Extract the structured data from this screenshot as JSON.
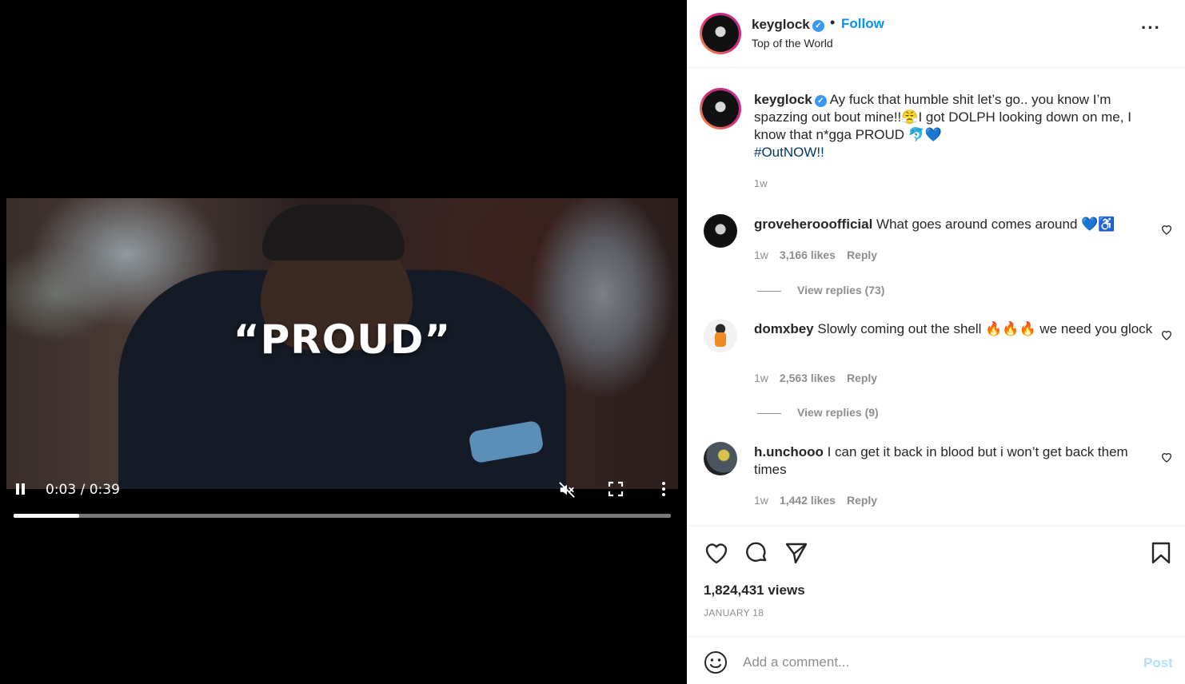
{
  "video": {
    "overlay_title": "“PROUD”",
    "time_label": "0:03 / 0:39",
    "progress_fraction": 0.1,
    "muted": true
  },
  "header": {
    "username": "keyglock",
    "verified": true,
    "separator": "•",
    "follow_label": "Follow",
    "subtitle": "Top of the World",
    "more_icon": "more-horizontal-icon"
  },
  "caption": {
    "username": "keyglock",
    "text": "Ay fuck that humble shit let’s go.. you know I’m spazzing out bout mine!!😤I got DOLPH looking down on me, I know that n*gga PROUD 🐬💙",
    "hashtag": "#OutNOW!!",
    "time": "1w"
  },
  "comments": [
    {
      "username": "groveherooofficial",
      "text": "What goes around comes around 💙♿",
      "time": "1w",
      "likes": "3,166 likes",
      "reply": "Reply",
      "view_replies": "View replies (73)"
    },
    {
      "username": "domxbey",
      "text": "Slowly coming out the shell 🔥🔥🔥 we need you glock",
      "time": "1w",
      "likes": "2,563 likes",
      "reply": "Reply",
      "view_replies": "View replies (9)"
    },
    {
      "username": "h.unchooo",
      "text": "I can get it back in blood but i won’t get back them times",
      "time": "1w",
      "likes": "1,442 likes",
      "reply": "Reply"
    }
  ],
  "actions": {
    "icons": [
      "heart-icon",
      "comment-icon",
      "share-icon",
      "bookmark-icon"
    ],
    "views": "1,824,431 views",
    "date": "JANUARY 18"
  },
  "comment_box": {
    "placeholder": "Add a comment...",
    "post_label": "Post"
  },
  "colors": {
    "link_blue": "#0095f6",
    "verified_blue": "#3897f0",
    "muted_text": "#8e8e8e",
    "post_disabled": "#b2dffc"
  }
}
